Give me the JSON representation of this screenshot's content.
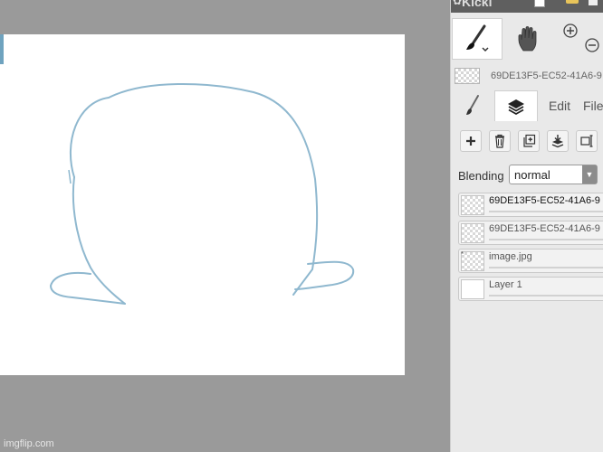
{
  "app": {
    "name": "Kicki"
  },
  "document": {
    "name": "69DE13F5-EC52-41A6-9"
  },
  "tabs": {
    "edit": "Edit",
    "file": "File"
  },
  "blending": {
    "label": "Blending",
    "value": "normal"
  },
  "layers": [
    {
      "name": "69DE13F5-EC52-41A6-9",
      "active": true,
      "thumb": "checker"
    },
    {
      "name": "69DE13F5-EC52-41A6-9",
      "active": false,
      "thumb": "checker"
    },
    {
      "name": "image.jpg",
      "active": false,
      "thumb": "checker"
    },
    {
      "name": "Layer 1",
      "active": false,
      "thumb": "white"
    }
  ],
  "watermark": "imgflip.com",
  "colors": {
    "sketch_stroke": "#8fb8cf",
    "workspace_bg": "#9a9a9a",
    "panel_bg": "#e9e9e9"
  },
  "icons": [
    "brush-icon",
    "hand-icon",
    "zoom-in-icon",
    "zoom-out-icon",
    "layers-icon",
    "add-layer-icon",
    "delete-layer-icon",
    "duplicate-layer-icon",
    "merge-layer-icon",
    "transform-icon"
  ]
}
